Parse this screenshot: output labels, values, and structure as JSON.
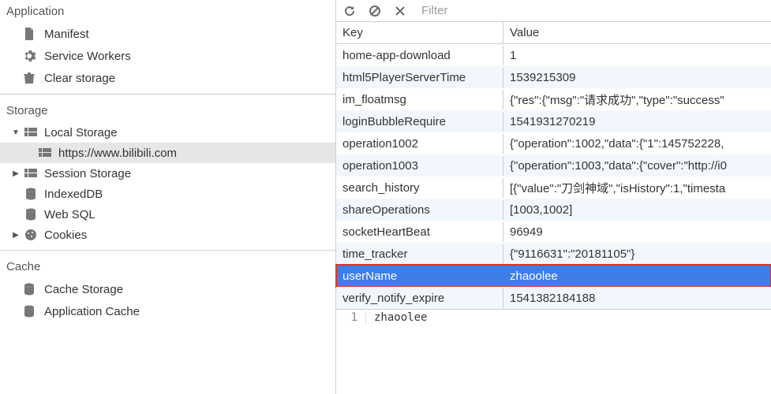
{
  "sidebar": {
    "application": {
      "title": "Application",
      "items": [
        {
          "label": "Manifest"
        },
        {
          "label": "Service Workers"
        },
        {
          "label": "Clear storage"
        }
      ]
    },
    "storage": {
      "title": "Storage",
      "localStorage": {
        "label": "Local Storage",
        "expanded": true,
        "children": [
          {
            "label": "https://www.bilibili.com"
          }
        ]
      },
      "sessionStorage": {
        "label": "Session Storage",
        "expanded": false
      },
      "indexeddb": {
        "label": "IndexedDB"
      },
      "websql": {
        "label": "Web SQL"
      },
      "cookies": {
        "label": "Cookies",
        "expanded": false
      }
    },
    "cache": {
      "title": "Cache",
      "items": [
        {
          "label": "Cache Storage"
        },
        {
          "label": "Application Cache"
        }
      ]
    }
  },
  "toolbar": {
    "filter_placeholder": "Filter"
  },
  "table": {
    "key_header": "Key",
    "value_header": "Value",
    "rows": [
      {
        "key": "home-app-download",
        "value": "1"
      },
      {
        "key": "html5PlayerServerTime",
        "value": "1539215309"
      },
      {
        "key": "im_floatmsg",
        "value": "{\"res\":{\"msg\":\"请求成功\",\"type\":\"success\""
      },
      {
        "key": "loginBubbleRequire",
        "value": "1541931270219"
      },
      {
        "key": "operation1002",
        "value": "{\"operation\":1002,\"data\":{\"1\":145752228,"
      },
      {
        "key": "operation1003",
        "value": "{\"operation\":1003,\"data\":{\"cover\":\"http://i0"
      },
      {
        "key": "search_history",
        "value": "[{\"value\":\"刀剑神域\",\"isHistory\":1,\"timesta"
      },
      {
        "key": "shareOperations",
        "value": "[1003,1002]"
      },
      {
        "key": "socketHeartBeat",
        "value": "96949"
      },
      {
        "key": "time_tracker",
        "value": "{\"9116631\":\"20181105\"}"
      },
      {
        "key": "userName",
        "value": "zhaoolee"
      },
      {
        "key": "verify_notify_expire",
        "value": "1541382184188"
      }
    ],
    "selected_index": 10,
    "highlight_index": 10
  },
  "valuepane": {
    "line": "1",
    "text": "zhaoolee"
  }
}
